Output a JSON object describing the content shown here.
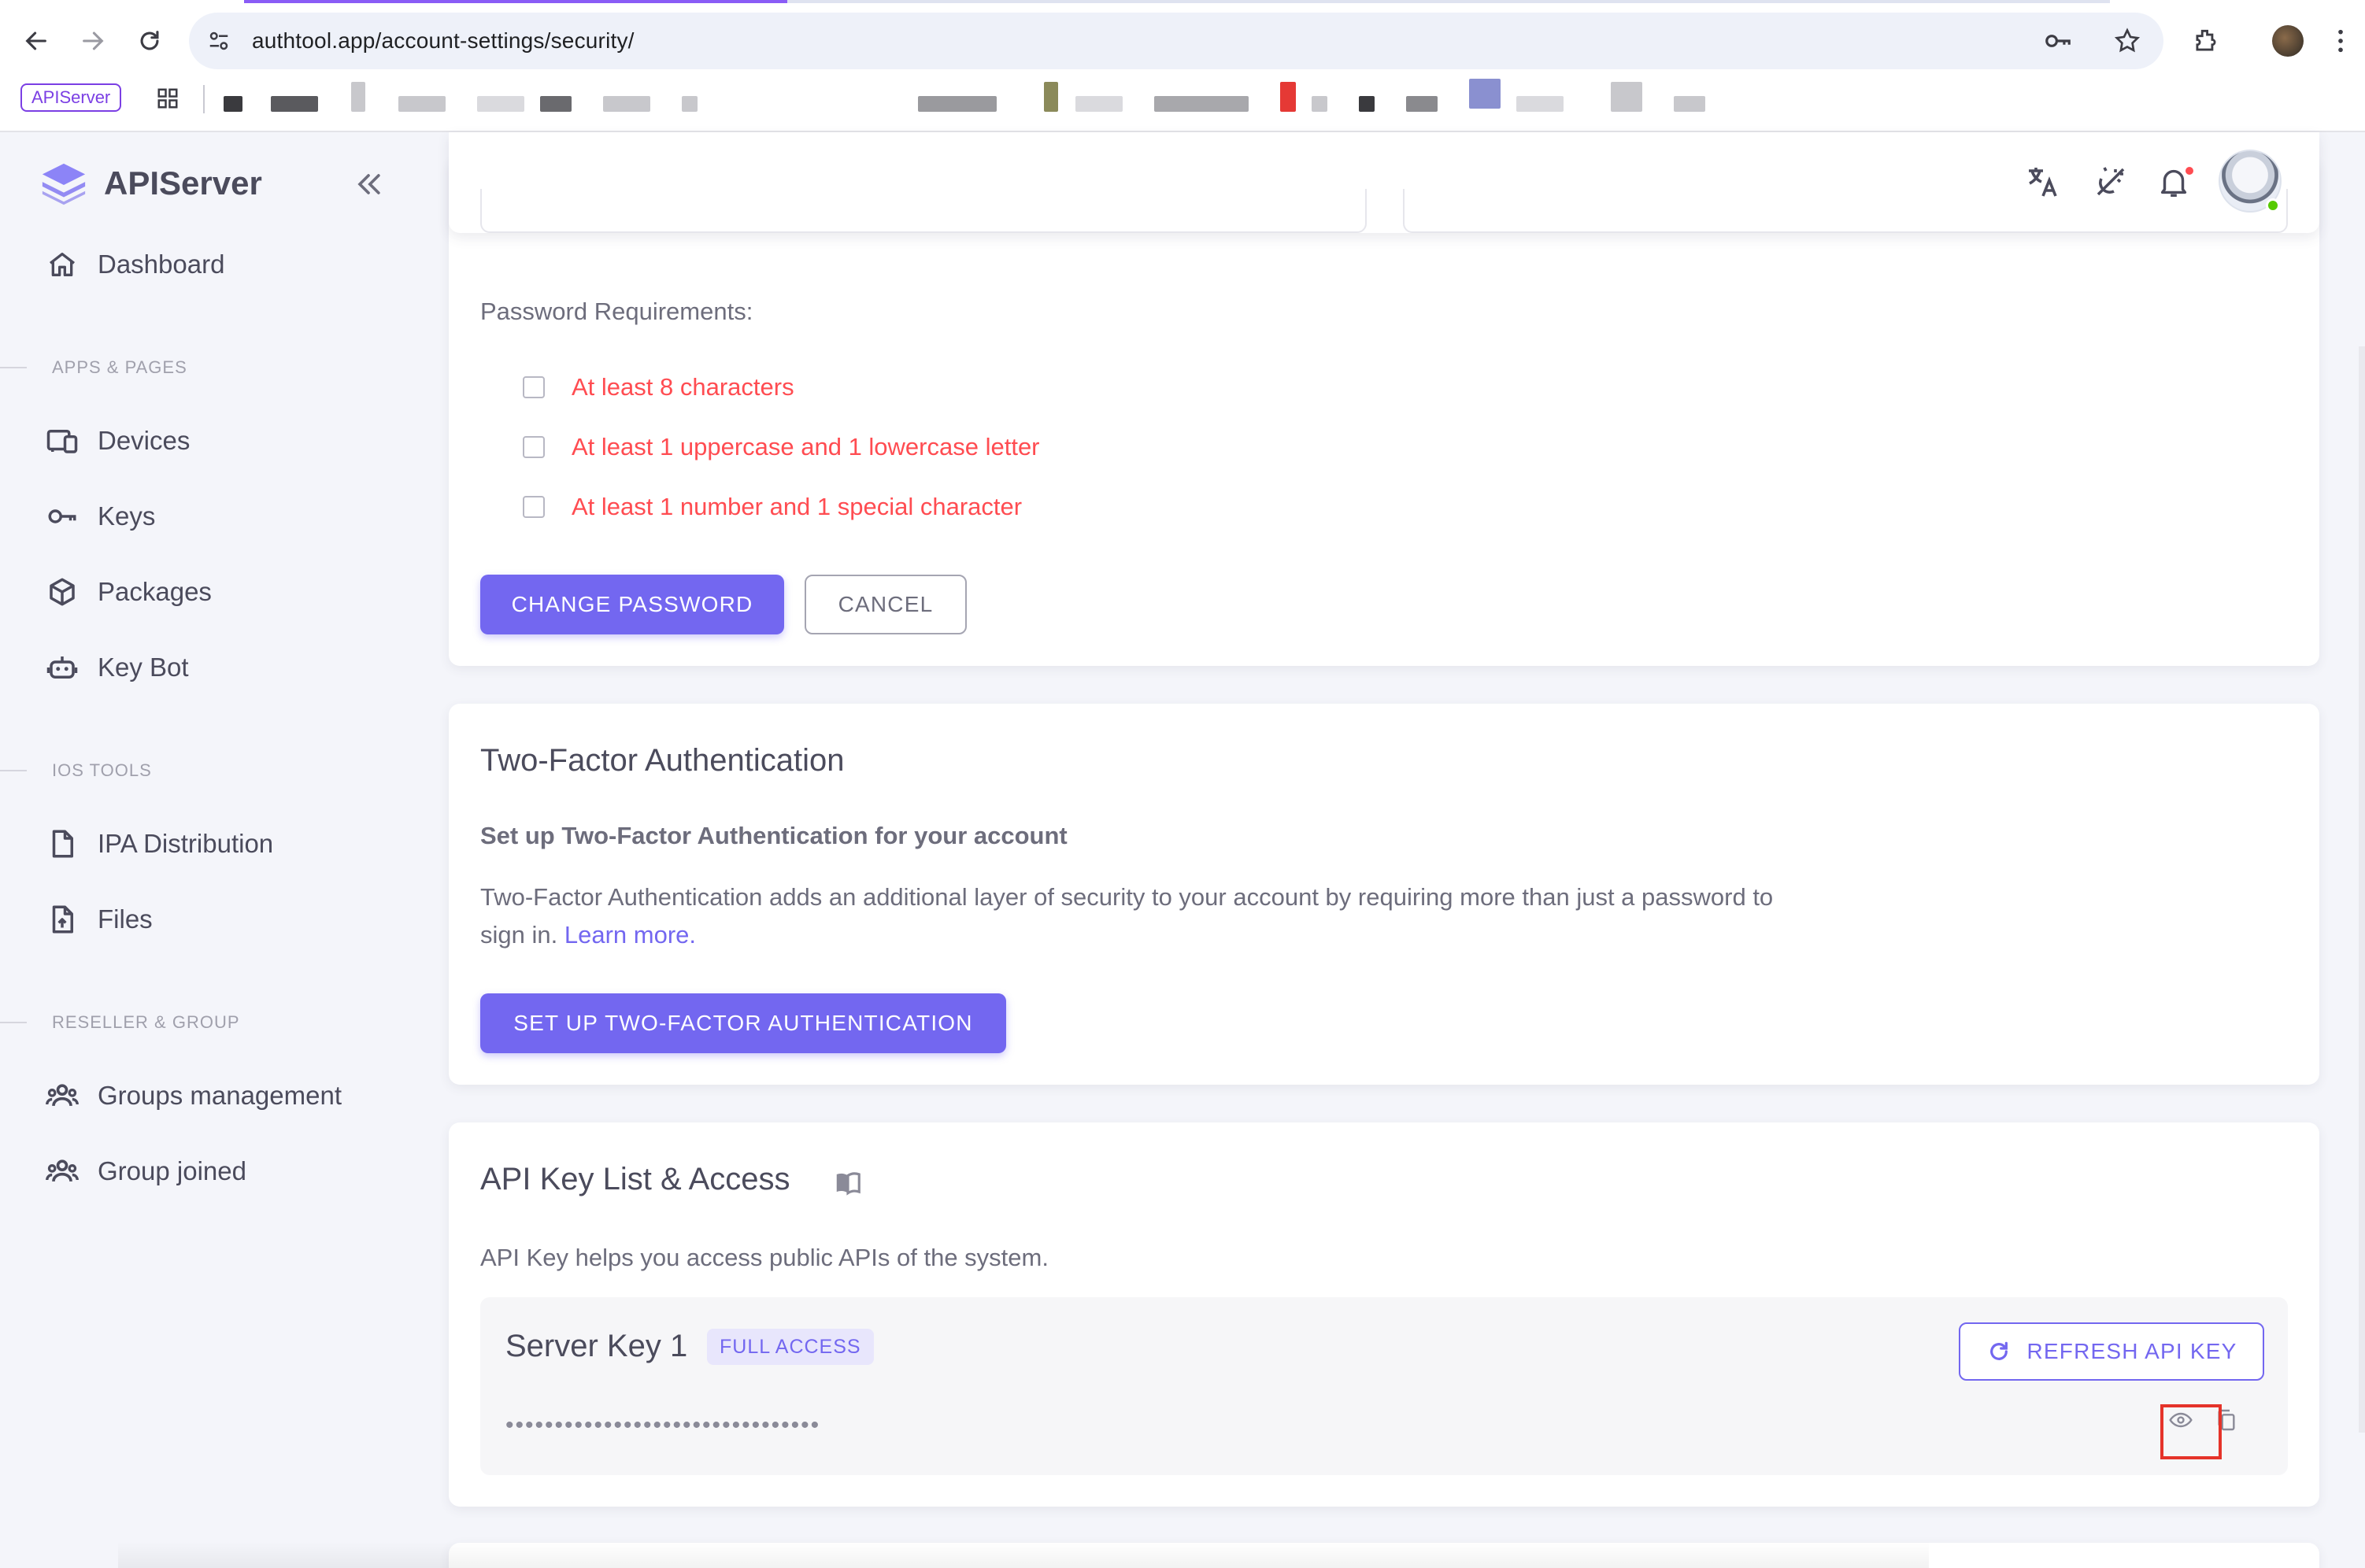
{
  "browser": {
    "url_host": "authtool.app",
    "url_path": "/account-settings/security/",
    "bookmark_chip": "APIServer"
  },
  "sidebar": {
    "brand": "APIServer",
    "dashboard": "Dashboard",
    "sections": {
      "apps": "APPS & PAGES",
      "ios": "IOS TOOLS",
      "reseller": "RESELLER & GROUP"
    },
    "items": {
      "devices": "Devices",
      "keys": "Keys",
      "packages": "Packages",
      "key_bot": "Key Bot",
      "ipa": "IPA Distribution",
      "files": "Files",
      "groups_management": "Groups management",
      "group_joined": "Group joined"
    }
  },
  "password": {
    "requirements_label": "Password Requirements:",
    "requirements": [
      "At least 8 characters",
      "At least 1 uppercase and 1 lowercase letter",
      "At least 1 number and 1 special character"
    ],
    "change_button": "CHANGE PASSWORD",
    "cancel_button": "CANCEL"
  },
  "two_factor": {
    "title": "Two-Factor Authentication",
    "subtitle": "Set up Two-Factor Authentication for your account",
    "text": "Two-Factor Authentication adds an additional layer of security to your account by requiring more than just a password to sign in.",
    "link": "Learn more.",
    "button": "SET UP TWO-FACTOR AUTHENTICATION"
  },
  "api": {
    "title": "API Key List & Access",
    "description": "API Key helps you access public APIs of the system.",
    "key_name": "Server Key 1",
    "key_badge": "FULL ACCESS",
    "key_mask": "••••••••••••••••••••••••••••••••",
    "refresh_button": "REFRESH API KEY"
  },
  "colors": {
    "primary": "#7367f0",
    "error": "#ff4c51",
    "online": "#56ca00"
  },
  "icons": [
    "back-icon",
    "forward-icon",
    "reload-icon",
    "site-settings-icon",
    "password-key-icon",
    "star-icon",
    "extensions-icon",
    "menu-icon",
    "apps-grid-icon",
    "collapse-icon",
    "home-icon",
    "devices-icon",
    "key-icon",
    "package-icon",
    "robot-icon",
    "file-icon",
    "file-upload-icon",
    "group-icon",
    "translate-icon",
    "theme-icon",
    "bell-icon",
    "book-icon",
    "refresh-icon",
    "eye-icon",
    "copy-icon"
  ]
}
